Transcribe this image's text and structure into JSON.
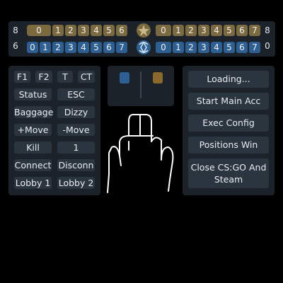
{
  "scoreboard": {
    "team_t_score": "8",
    "team_ct_score": "6",
    "right_t_score": "8",
    "right_ct_score": "0",
    "left_t_chips": [
      "0",
      "1",
      "2",
      "3",
      "4",
      "5",
      "6"
    ],
    "left_ct_chips": [
      "0",
      "1",
      "2",
      "3",
      "4",
      "5",
      "6",
      "7"
    ],
    "right_t_chips": [
      "0",
      "1",
      "2",
      "3",
      "4",
      "5",
      "6",
      "7"
    ],
    "right_ct_chips": [
      "0",
      "1",
      "2",
      "3",
      "4",
      "5",
      "6",
      "7"
    ],
    "icons": [
      "terrorist-emblem-icon",
      "counter-terrorist-emblem-icon"
    ]
  },
  "commands": {
    "row1": [
      "F1",
      "F2",
      "T",
      "CT"
    ],
    "grid": [
      [
        "Status",
        "ESC"
      ],
      [
        "Baggage",
        "Dizzy"
      ],
      [
        "+Move",
        "-Move"
      ],
      [
        "Kill",
        "1"
      ],
      [
        "Connect",
        "Disconn"
      ],
      [
        "Lobby 1",
        "Lobby 2"
      ]
    ]
  },
  "slots": {
    "left_color": "#2d5f93",
    "right_color": "#8a6a2c"
  },
  "actions": {
    "loading": "Loading...",
    "start_main": "Start Main Acc",
    "exec_config": "Exec Config",
    "positions_win": "Positions Win",
    "close": "Close CS:GO And Steam"
  },
  "colors": {
    "panel": "#1b2229",
    "button": "#2b3540",
    "t_chip": "#7b6a3f",
    "ct_chip": "#2d5f93"
  },
  "gesture": "middle-finger-drawing"
}
